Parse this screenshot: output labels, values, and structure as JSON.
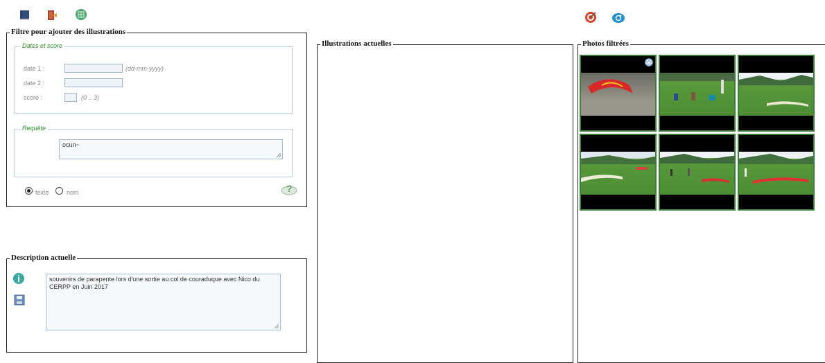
{
  "toolbar": {
    "left_icons": [
      "book-icon",
      "exit-icon",
      "grid-icon"
    ],
    "right_icons": [
      "target-icon",
      "refresh-icon"
    ]
  },
  "filter": {
    "title": "Filtre pour ajouter des illustrations",
    "dates_group": {
      "legend": "Dates et score",
      "date1_label": "date 1 :",
      "date1_value": "",
      "date1_hint": "(dd-mm-yyyy)",
      "date2_label": "date 2 :",
      "date2_value": "",
      "score_label": "score :",
      "score_value": "",
      "score_hint": "(0 .. 3)"
    },
    "query_group": {
      "legend": "Requête",
      "value": "ocun~"
    },
    "mode": {
      "options": [
        "texte",
        "nom"
      ],
      "selected": "texte"
    },
    "help_icon": "help-cloud-icon"
  },
  "description": {
    "title": "Description actuelle",
    "text": "souvenirs de parapente lors d'une sortie au col de couraduque avec Nico du CERPP en Juin 2017",
    "icons": [
      "info-icon",
      "save-icon"
    ]
  },
  "current_illustrations": {
    "title": "Illustrations actuelles"
  },
  "filtered_photos": {
    "title": "Photos filtrées",
    "photos": [
      {
        "name": "photo-1",
        "scene": "glider-on-rocks",
        "badge": "star-icon"
      },
      {
        "name": "photo-2",
        "scene": "meadow-people"
      },
      {
        "name": "photo-3",
        "scene": "meadow-glider"
      },
      {
        "name": "photo-4",
        "scene": "meadow-gliders"
      },
      {
        "name": "photo-5",
        "scene": "meadow-crowd"
      },
      {
        "name": "photo-6",
        "scene": "meadow-red-glider"
      }
    ]
  },
  "colors": {
    "thumb_border": "#3c7d3c",
    "legend_green": "#2e8b2e",
    "input_border": "#9fb3c8"
  }
}
